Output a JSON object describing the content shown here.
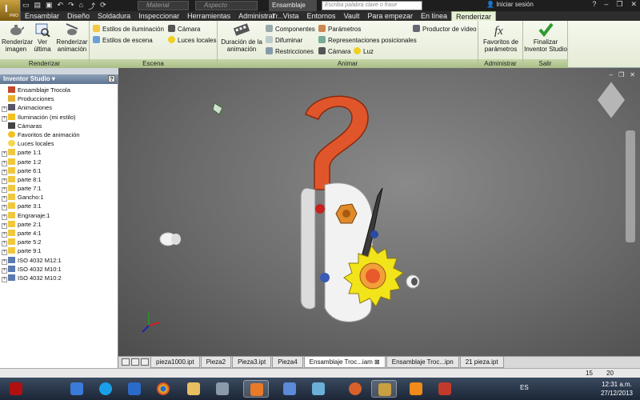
{
  "titlebar": {
    "pro_badge": "PRO",
    "material_placeholder": "Material",
    "aspect_placeholder": "Aspecto",
    "doc_title": "Ensamblaje Tr...",
    "search_placeholder": "Escriba palabra clave o frase",
    "signin": "Iniciar sesión"
  },
  "tabs": [
    "Ensamblar",
    "Diseño",
    "Soldadura",
    "Inspeccionar",
    "Herramientas",
    "Administrar",
    "Vista",
    "Entornos",
    "Vault",
    "Para empezar",
    "En línea",
    "Renderizar"
  ],
  "ribbon": {
    "render_panel": {
      "title": "Renderizar",
      "render_image": "Renderizar imagen",
      "view_last": "Ver última",
      "render_animation": "Renderizar animación"
    },
    "scene_panel": {
      "title": "Escena",
      "lighting_styles": "Estilos de iluminación",
      "scene_styles": "Estilos de escena",
      "camera": "Cámara",
      "local_lights": "Luces locales"
    },
    "animate_panel": {
      "title": "Animar",
      "animation_duration": "Duración de la animación",
      "components": "Componentes",
      "fade": "Difuminar",
      "constraints": "Restricciones",
      "parameters": "Parámetros",
      "positional_reps": "Representaciones posicionales",
      "camera": "Cámara",
      "light": "Luz",
      "video_producer": "Productor de vídeo"
    },
    "manage_panel": {
      "title": "Administrar",
      "param_favorites": "Favoritos de parámetros"
    },
    "exit_panel": {
      "title": "Salir",
      "finish": "Finalizar Inventor Studio"
    }
  },
  "browser": {
    "title": "Inventor Studio ▾",
    "help": "?",
    "nodes": [
      {
        "label": "Ensamblaje Trocola",
        "expand": false,
        "icon": "assembly-icon"
      },
      {
        "label": "Producciones",
        "expand": false,
        "icon": "production-icon"
      },
      {
        "label": "Animaciones",
        "expand": true,
        "icon": "animation-icon"
      },
      {
        "label": "Iluminación (mi estilo)",
        "expand": true,
        "icon": "lighting-icon"
      },
      {
        "label": "Cámaras",
        "expand": false,
        "icon": "camera-icon"
      },
      {
        "label": "Favoritos de animación",
        "expand": false,
        "icon": "star-icon"
      },
      {
        "label": "Luces locales",
        "expand": false,
        "icon": "bulb-icon"
      },
      {
        "label": "parte 1:1",
        "expand": true,
        "icon": "part-icon"
      },
      {
        "label": "parte 1:2",
        "expand": true,
        "icon": "part-icon"
      },
      {
        "label": "parte 6:1",
        "expand": true,
        "icon": "part-icon"
      },
      {
        "label": "parte 8:1",
        "expand": true,
        "icon": "part-icon"
      },
      {
        "label": "parte 7:1",
        "expand": true,
        "icon": "part-icon"
      },
      {
        "label": "Gancho:1",
        "expand": true,
        "icon": "part-icon"
      },
      {
        "label": "parte 3:1",
        "expand": true,
        "icon": "part-icon"
      },
      {
        "label": "Engranaje:1",
        "expand": true,
        "icon": "part-icon"
      },
      {
        "label": "parte 2:1",
        "expand": true,
        "icon": "part-icon"
      },
      {
        "label": "parte 4:1",
        "expand": true,
        "icon": "part-icon"
      },
      {
        "label": "parte 5:2",
        "expand": true,
        "icon": "part-icon"
      },
      {
        "label": "parte 9:1",
        "expand": true,
        "icon": "part-icon"
      },
      {
        "label": "ISO 4032 M12:1",
        "expand": true,
        "icon": "nut-icon"
      },
      {
        "label": "ISO 4032 M10:1",
        "expand": true,
        "icon": "nut-icon"
      },
      {
        "label": "ISO 4032 M10:2",
        "expand": true,
        "icon": "nut-icon"
      }
    ]
  },
  "doc_tabs": [
    "pieza1000.ipt",
    "Pieza2",
    "Pieza3.ipt",
    "Pieza4",
    "Ensamblaje Troc...iam ⊠",
    "Ensamblaje Troc...ipn",
    "21 pieza.ipt"
  ],
  "active_doc_tab": 4,
  "status": {
    "num1": "15",
    "num2": "20"
  },
  "taskbar": {
    "lang": "ES",
    "time": "12:31 a.m.",
    "date": "27/12/2013"
  },
  "colors": {
    "ribbon_accent": "#a9be86",
    "hook": "#e0562a",
    "gear": "#f2e41a",
    "plate": "#f2f2f2",
    "pawl": "#3a3a3a"
  }
}
